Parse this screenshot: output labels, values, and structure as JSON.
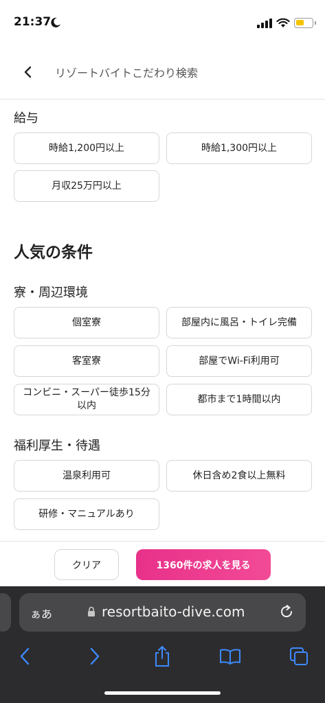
{
  "status": {
    "time": "21:37"
  },
  "header": {
    "title": "リゾートバイトこだわり検索"
  },
  "salary": {
    "heading": "給与",
    "options": [
      "時給1,200円以上",
      "時給1,300円以上",
      "月収25万円以上"
    ]
  },
  "popular": {
    "heading": "人気の条件",
    "dorm": {
      "heading": "寮・周辺環境",
      "options": [
        "個室寮",
        "部屋内に風呂・トイレ完備",
        "客室寮",
        "部屋でWi-Fi利用可",
        "コンビニ・スーパー徒歩15分以内",
        "都市まで1時間以内"
      ]
    },
    "welfare": {
      "heading": "福利厚生・待遇",
      "options": [
        "温泉利用可",
        "休日含め2食以上無料",
        "研修・マニュアルあり"
      ]
    }
  },
  "footer": {
    "clear_label": "クリア",
    "search_label": "1360件の求人を見る"
  },
  "browser": {
    "aa_label": "ぁあ",
    "url": "resortbaito-dive.com"
  },
  "colors": {
    "accent": "#e8318a",
    "toolbar_icon": "#3d8bff",
    "battery": "#f5c400"
  }
}
